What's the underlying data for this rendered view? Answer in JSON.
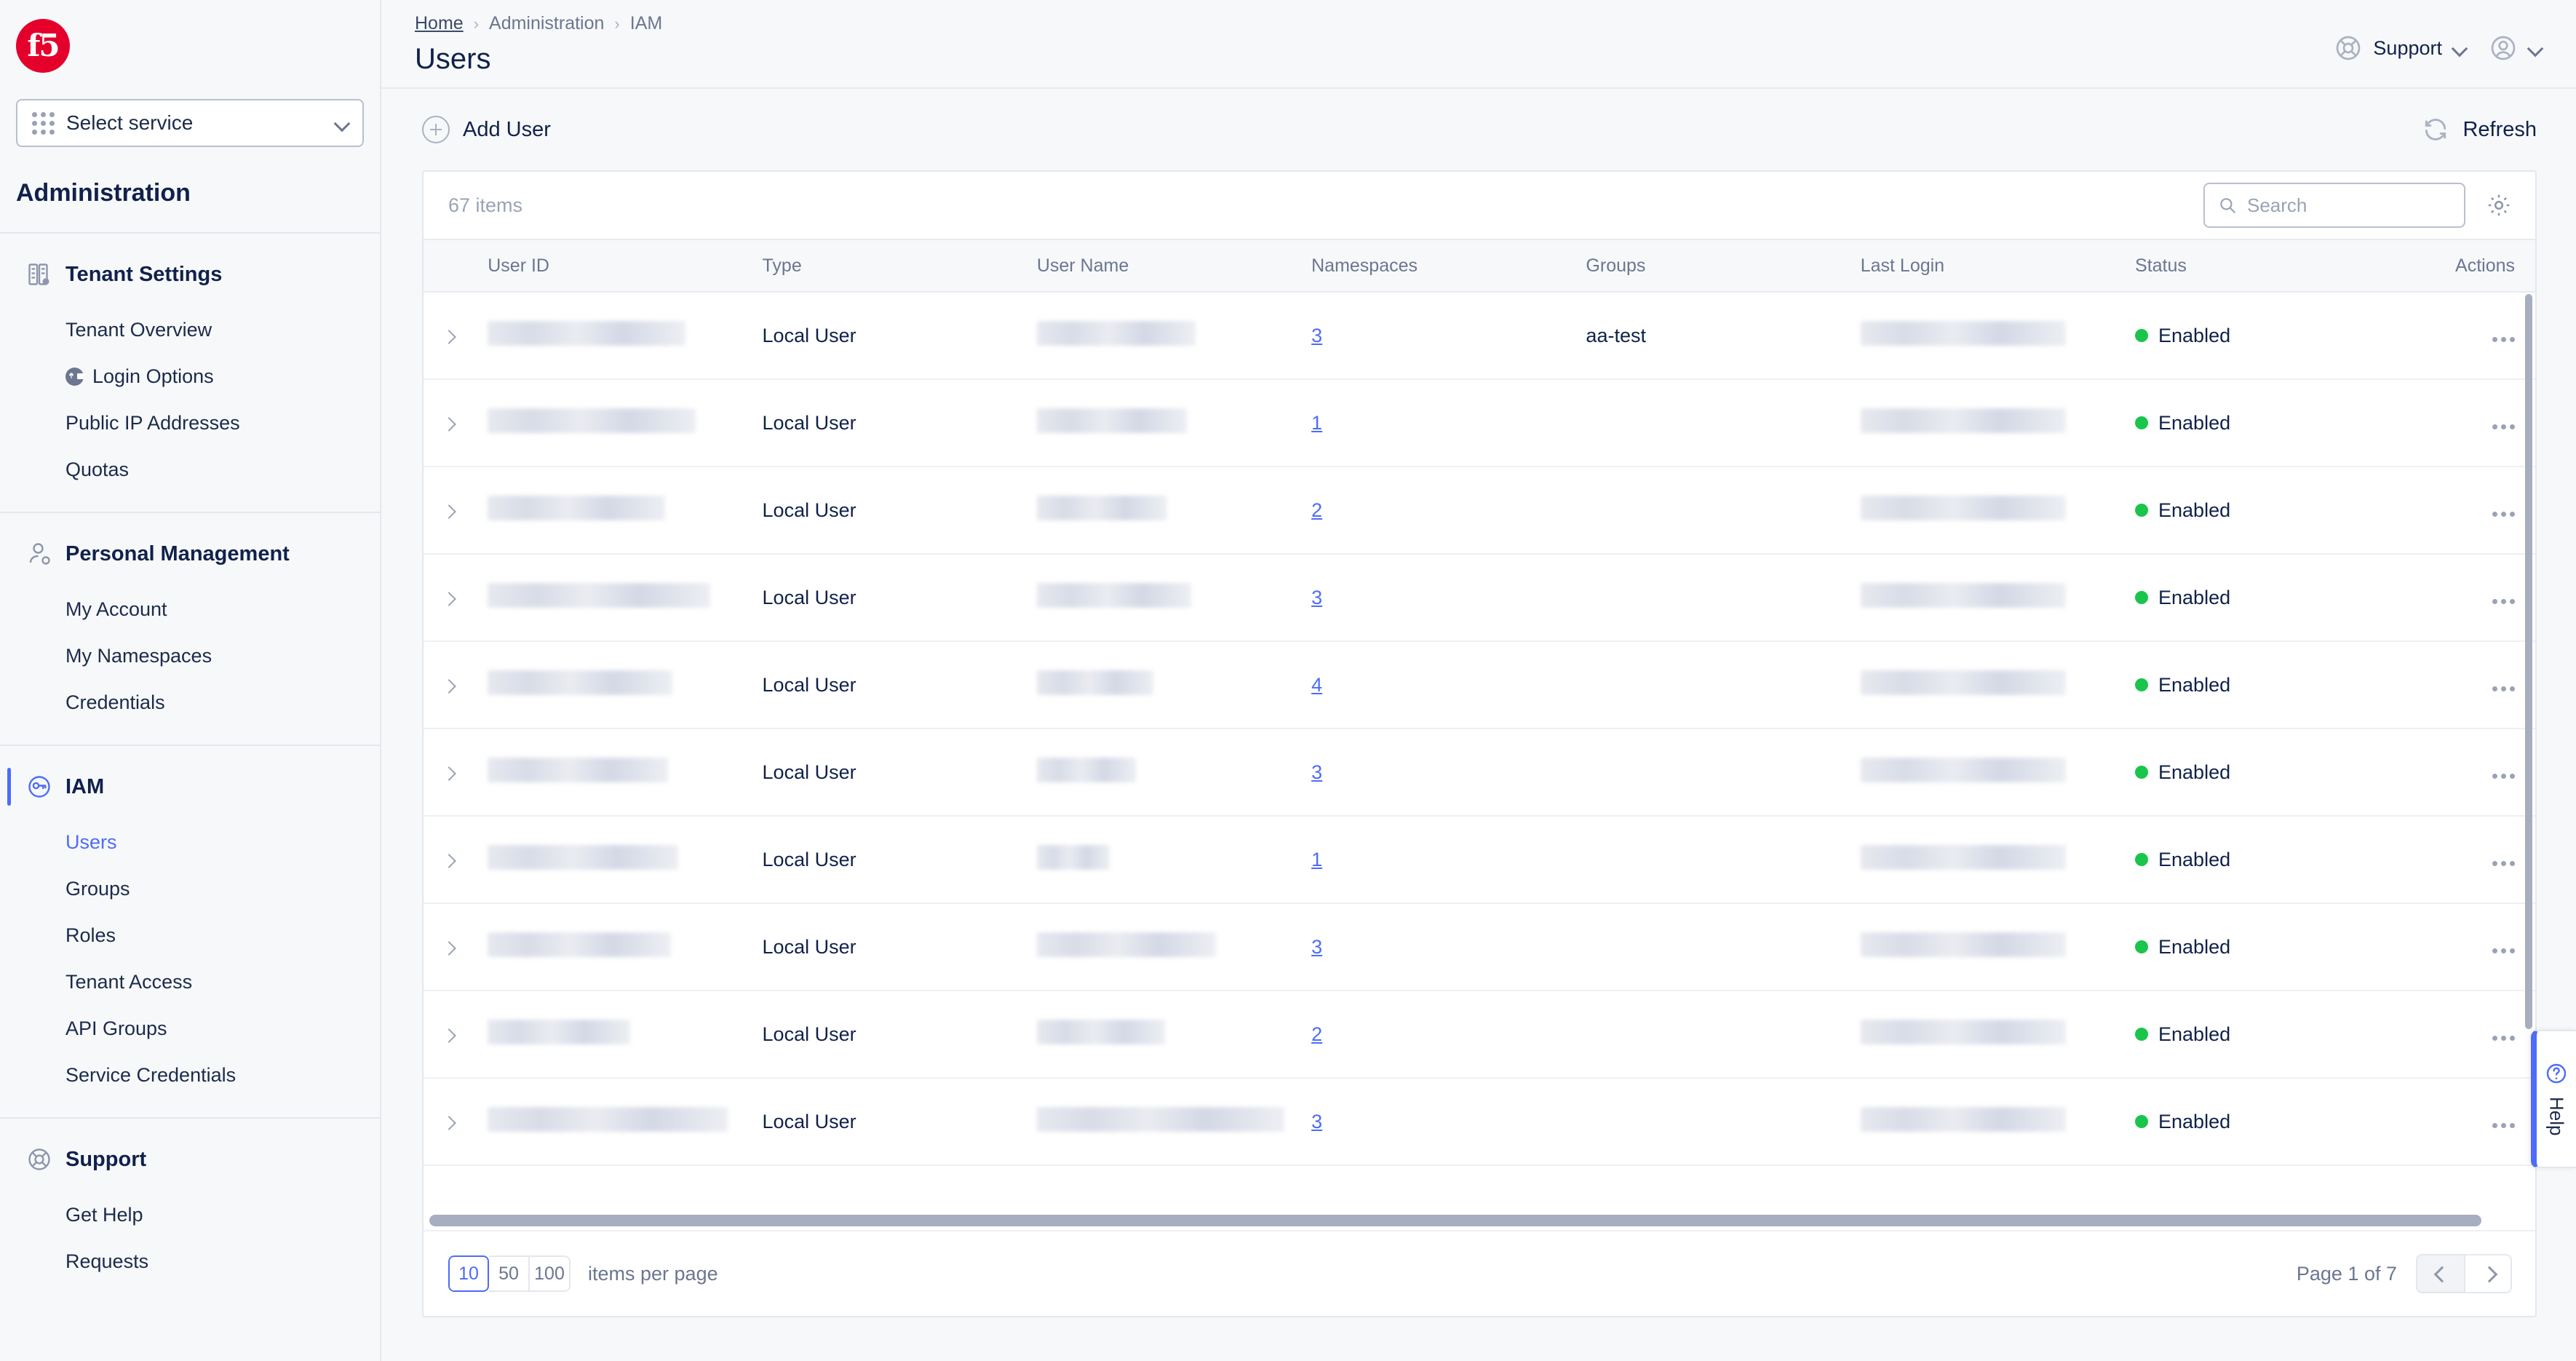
{
  "sidebar": {
    "logo_text": "f5",
    "service_select": {
      "label": "Select service",
      "icon": "apps-grid-icon",
      "chevron": "chevron-down-icon"
    },
    "section_title": "Administration",
    "groups": [
      {
        "label": "Tenant Settings",
        "icon": "building-settings-icon",
        "active": false,
        "items": [
          {
            "label": "Tenant Overview",
            "badge": null,
            "active": false
          },
          {
            "label": "Login Options",
            "badge": "lock-icon",
            "active": false
          },
          {
            "label": "Public IP Addresses",
            "badge": null,
            "active": false
          },
          {
            "label": "Quotas",
            "badge": null,
            "active": false
          }
        ]
      },
      {
        "label": "Personal Management",
        "icon": "person-settings-icon",
        "active": false,
        "items": [
          {
            "label": "My Account",
            "badge": null,
            "active": false
          },
          {
            "label": "My Namespaces",
            "badge": null,
            "active": false
          },
          {
            "label": "Credentials",
            "badge": null,
            "active": false
          }
        ]
      },
      {
        "label": "IAM",
        "icon": "key-circle-icon",
        "active": true,
        "items": [
          {
            "label": "Users",
            "badge": null,
            "active": true
          },
          {
            "label": "Groups",
            "badge": null,
            "active": false
          },
          {
            "label": "Roles",
            "badge": null,
            "active": false
          },
          {
            "label": "Tenant Access",
            "badge": null,
            "active": false
          },
          {
            "label": "API Groups",
            "badge": null,
            "active": false
          },
          {
            "label": "Service Credentials",
            "badge": null,
            "active": false
          }
        ]
      },
      {
        "label": "Support",
        "icon": "lifebuoy-icon",
        "active": false,
        "items": [
          {
            "label": "Get Help",
            "badge": null,
            "active": false
          },
          {
            "label": "Requests",
            "badge": null,
            "active": false
          }
        ]
      }
    ]
  },
  "header": {
    "breadcrumb": [
      {
        "label": "Home",
        "link": true
      },
      {
        "label": "Administration",
        "link": false
      },
      {
        "label": "IAM",
        "link": false
      }
    ],
    "separator": "›",
    "title": "Users",
    "support": {
      "label": "Support",
      "icon": "lifebuoy-icon",
      "chevron": "chevron-down-icon"
    },
    "account": {
      "icon": "user-avatar-icon",
      "chevron": "chevron-down-icon"
    }
  },
  "toolbar": {
    "add_user_label": "Add User",
    "add_user_icon": "plus-circle-icon",
    "refresh_label": "Refresh",
    "refresh_icon": "refresh-icon"
  },
  "table_card": {
    "items_count": "67 items",
    "search": {
      "placeholder": "Search",
      "value": "",
      "icon": "search-icon"
    },
    "settings_icon": "gear-icon",
    "columns": [
      "User ID",
      "Type",
      "User Name",
      "Namespaces",
      "Groups",
      "Last Login",
      "Status",
      "Actions"
    ],
    "rows": [
      {
        "user_id": "",
        "type": "Local User",
        "user_name": "",
        "namespaces": "3",
        "groups": "aa-test",
        "last_login": "",
        "status": "Enabled",
        "uid_w": 272,
        "uname_w": 218,
        "last_w": 282
      },
      {
        "user_id": "",
        "type": "Local User",
        "user_name": "",
        "namespaces": "1",
        "groups": "",
        "last_login": "",
        "status": "Enabled",
        "uid_w": 286,
        "uname_w": 206,
        "last_w": 282
      },
      {
        "user_id": "",
        "type": "Local User",
        "user_name": "",
        "namespaces": "2",
        "groups": "",
        "last_login": "",
        "status": "Enabled",
        "uid_w": 244,
        "uname_w": 178,
        "last_w": 282
      },
      {
        "user_id": "",
        "type": "Local User",
        "user_name": "",
        "namespaces": "3",
        "groups": "",
        "last_login": "",
        "status": "Enabled",
        "uid_w": 306,
        "uname_w": 212,
        "last_w": 282
      },
      {
        "user_id": "",
        "type": "Local User",
        "user_name": "",
        "namespaces": "4",
        "groups": "",
        "last_login": "",
        "status": "Enabled",
        "uid_w": 254,
        "uname_w": 160,
        "last_w": 282
      },
      {
        "user_id": "",
        "type": "Local User",
        "user_name": "",
        "namespaces": "3",
        "groups": "",
        "last_login": "",
        "status": "Enabled",
        "uid_w": 248,
        "uname_w": 136,
        "last_w": 282
      },
      {
        "user_id": "",
        "type": "Local User",
        "user_name": "",
        "namespaces": "1",
        "groups": "",
        "last_login": "",
        "status": "Enabled",
        "uid_w": 262,
        "uname_w": 100,
        "last_w": 282
      },
      {
        "user_id": "",
        "type": "Local User",
        "user_name": "",
        "namespaces": "3",
        "groups": "",
        "last_login": "",
        "status": "Enabled",
        "uid_w": 252,
        "uname_w": 246,
        "last_w": 282
      },
      {
        "user_id": "",
        "type": "Local User",
        "user_name": "",
        "namespaces": "2",
        "groups": "",
        "last_login": "",
        "status": "Enabled",
        "uid_w": 196,
        "uname_w": 176,
        "last_w": 282
      },
      {
        "user_id": "",
        "type": "Local User",
        "user_name": "",
        "namespaces": "3",
        "groups": "",
        "last_login": "",
        "status": "Enabled",
        "uid_w": 330,
        "uname_w": 340,
        "last_w": 282
      }
    ],
    "row_actions_icon": "kebab-menu-icon",
    "expand_icon": "chevron-right-icon",
    "status_dot_color": "#19c64b"
  },
  "footer": {
    "page_sizes": [
      "10",
      "50",
      "100"
    ],
    "page_size_selected": "10",
    "items_per_page_label": "items per page",
    "page_label": "Page 1 of 7",
    "prev_icon": "chevron-left-icon",
    "next_icon": "chevron-right-icon"
  },
  "help_tab": {
    "label": "Help",
    "icon": "question-circle-icon",
    "accent": "#4d6cfa"
  }
}
